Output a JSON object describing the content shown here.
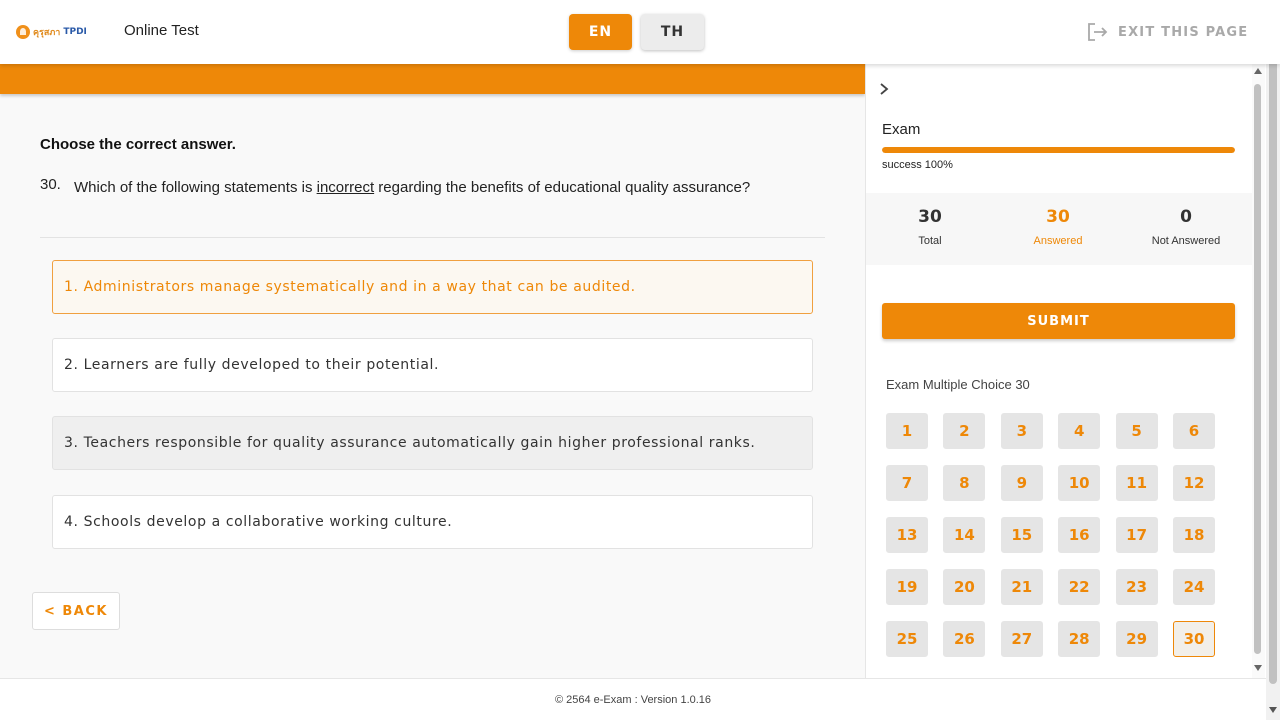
{
  "header": {
    "logo_thai": "คุรุสภา",
    "logo_brand": "TPDI",
    "app_title": "Online Test",
    "lang_en": "EN",
    "lang_th": "TH",
    "exit_label": "EXIT THIS PAGE"
  },
  "question": {
    "instruction": "Choose the correct answer.",
    "number": "30.",
    "text_before": "Which of the following statements is ",
    "text_emph": "incorrect",
    "text_after": " regarding the benefits of educational quality assurance?",
    "options": [
      {
        "label": "1. Administrators manage systematically and in a way that can be audited.",
        "state": "selected"
      },
      {
        "label": "2. Learners are fully developed to their potential.",
        "state": "normal"
      },
      {
        "label": "3. Teachers responsible for quality assurance automatically gain higher professional ranks.",
        "state": "hover"
      },
      {
        "label": "4. Schools develop a collaborative working culture.",
        "state": "normal"
      }
    ],
    "back_label": "< BACK"
  },
  "sidebar": {
    "exam_label": "Exam",
    "progress_percent": 100,
    "progress_text": "success 100%",
    "stats": {
      "total_value": "30",
      "total_label": "Total",
      "answered_value": "30",
      "answered_label": "Answered",
      "not_answered_value": "0",
      "not_answered_label": "Not Answered"
    },
    "submit_label": "SUBMIT",
    "grid_title": "Exam Multiple Choice 30",
    "question_numbers": [
      "1",
      "2",
      "3",
      "4",
      "5",
      "6",
      "7",
      "8",
      "9",
      "10",
      "11",
      "12",
      "13",
      "14",
      "15",
      "16",
      "17",
      "18",
      "19",
      "20",
      "21",
      "22",
      "23",
      "24",
      "25",
      "26",
      "27",
      "28",
      "29",
      "30"
    ],
    "current_question": "30"
  },
  "footer": {
    "text": "© 2564 e-Exam : Version 1.0.16"
  },
  "colors": {
    "accent": "#ee8808",
    "selected_bg": "#fcf8f1"
  }
}
